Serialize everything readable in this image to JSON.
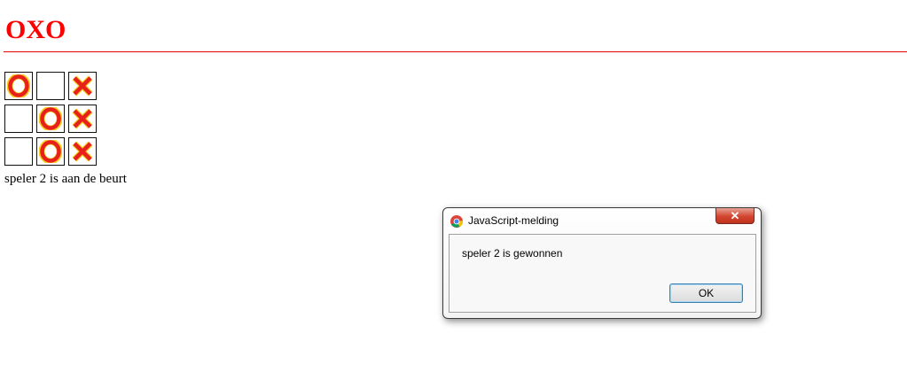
{
  "page": {
    "title": "OXO",
    "status": "speler 2 is aan de beurt"
  },
  "board": [
    [
      "O",
      "",
      "X"
    ],
    [
      "",
      "O",
      "X"
    ],
    [
      "",
      "O",
      "X"
    ]
  ],
  "colors": {
    "title": "#ff0000",
    "mark": "#e8201c",
    "mark_glow": "#f5d020"
  },
  "dialog": {
    "title": "JavaScript-melding",
    "message": "speler 2 is gewonnen",
    "ok_label": "OK",
    "icon": "chrome-icon",
    "close_icon": "close-icon"
  }
}
